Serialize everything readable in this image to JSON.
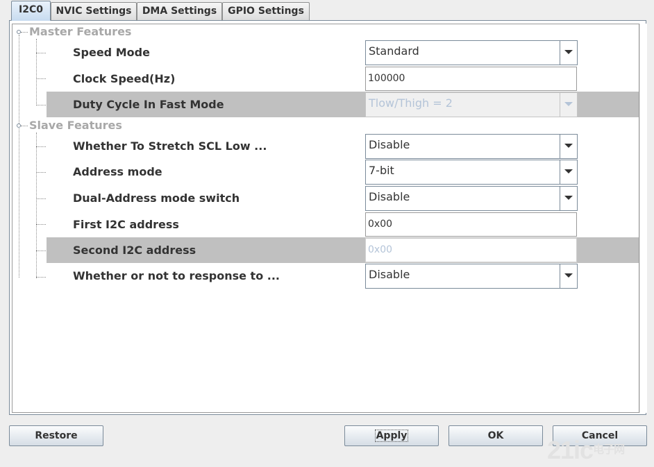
{
  "tabs": [
    {
      "label": "I2C0",
      "active": true
    },
    {
      "label": "NVIC Settings",
      "active": false
    },
    {
      "label": "DMA Settings",
      "active": false
    },
    {
      "label": "GPIO Settings",
      "active": false
    }
  ],
  "master": {
    "title": "Master Features",
    "params": [
      {
        "label": "Speed Mode",
        "type": "combo",
        "value": "Standard",
        "enabled": true
      },
      {
        "label": "Clock Speed(Hz)",
        "type": "text",
        "value": "100000",
        "enabled": true
      },
      {
        "label": "Duty Cycle In Fast Mode",
        "type": "combo",
        "value": "Tlow/Thigh = 2",
        "enabled": false
      }
    ]
  },
  "slave": {
    "title": "Slave Features",
    "params": [
      {
        "label": "Whether To Stretch SCL Low ...",
        "type": "combo",
        "value": "Disable",
        "enabled": true
      },
      {
        "label": "Address mode",
        "type": "combo",
        "value": "7-bit",
        "enabled": true
      },
      {
        "label": "Dual-Address mode switch",
        "type": "combo",
        "value": "Disable",
        "enabled": true
      },
      {
        "label": "First I2C address",
        "type": "text",
        "value": "0x00",
        "enabled": true
      },
      {
        "label": "Second I2C address",
        "type": "text",
        "value": "0x00",
        "enabled": false
      },
      {
        "label": "Whether or not to response to ...",
        "type": "combo",
        "value": "Disable",
        "enabled": true
      }
    ]
  },
  "buttons": {
    "restore": "Restore",
    "apply": "Apply",
    "ok": "OK",
    "cancel": "Cancel"
  },
  "watermark": {
    "text": "21ic",
    "sub": "电子网"
  },
  "colors": {
    "disabled_row": "#c0c0c0",
    "category_text": "#a8a8a8",
    "disabled_value": "#b4c4d8",
    "tab_active": "#c8dcf0"
  }
}
